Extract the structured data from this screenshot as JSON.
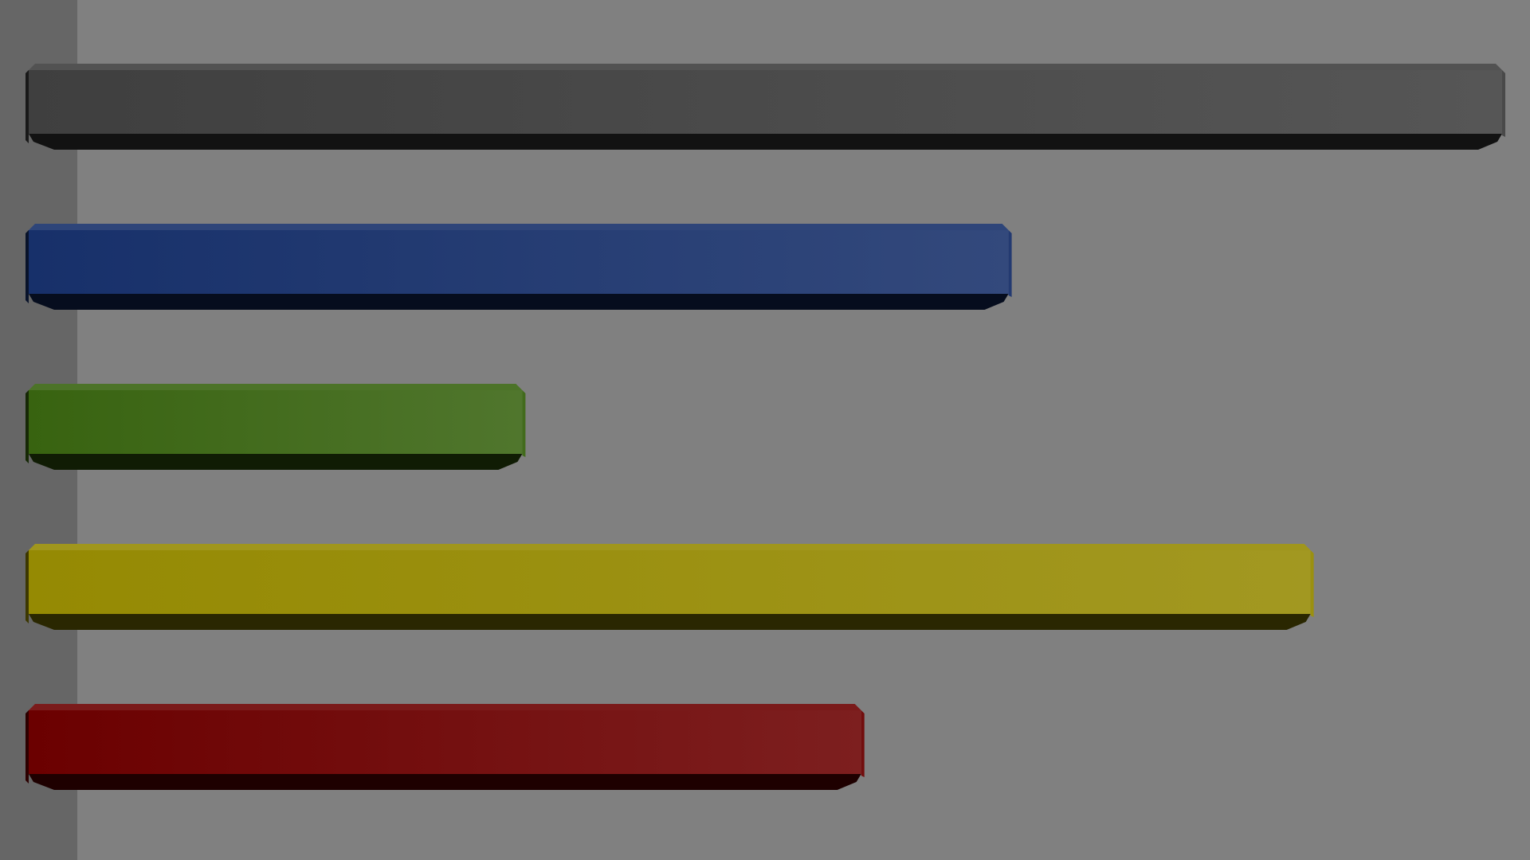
{
  "background_color": "#808080",
  "left_panel_color": "#666666",
  "chart_data": {
    "type": "bar",
    "orientation": "horizontal",
    "style": "3d-beveled",
    "grid": false,
    "legend": "none",
    "xlim": [
      0,
      100
    ],
    "series": [
      {
        "values": [
          100,
          66.5,
          33.5,
          87.0,
          56.5
        ],
        "colors": [
          "#3f3f3f",
          "#17306a",
          "#386310",
          "#958a03",
          "#6b0000"
        ]
      }
    ]
  }
}
